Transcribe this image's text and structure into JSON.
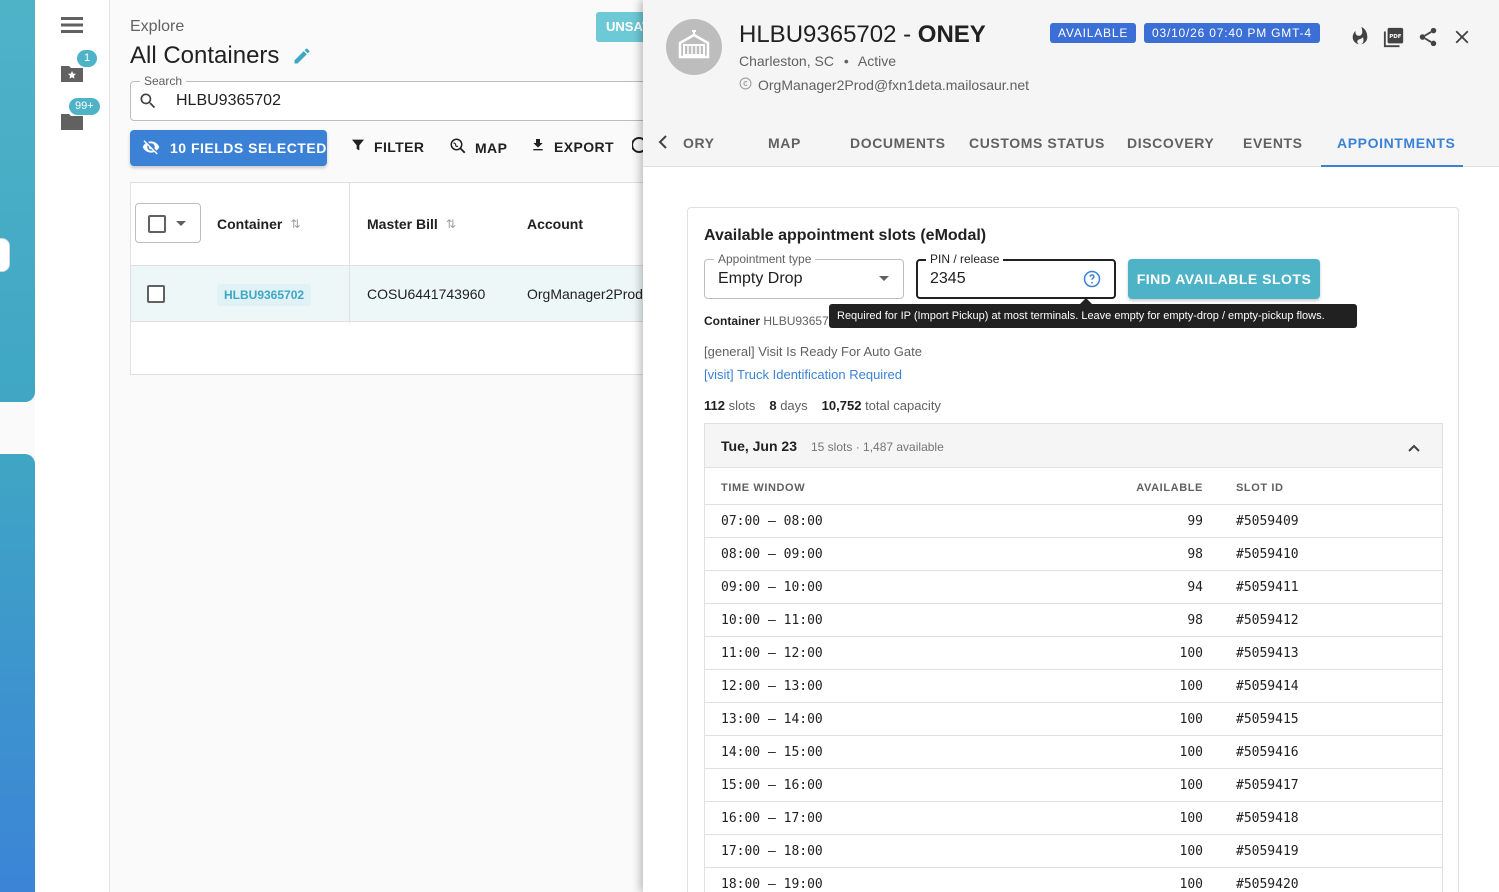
{
  "rail": {
    "favorites_badge": "1",
    "folders_badge": "99+"
  },
  "explore": {
    "section_label": "Explore",
    "page_title": "All Containers",
    "unsaved_label": "UNSAVED",
    "search_label": "Search",
    "search_value": "HLBU9365702",
    "fields_button": "10 FIELDS SELECTED",
    "filter_button": "FILTER",
    "map_button": "MAP",
    "export_button": "EXPORT",
    "columns": {
      "container": "Container",
      "master_bill": "Master Bill",
      "account": "Account"
    },
    "row": {
      "container": "HLBU9365702",
      "master_bill": "COSU6441743960",
      "account": "OrgManager2Prod"
    }
  },
  "detail": {
    "container_id": "HLBU9365702",
    "carrier": "ONEY",
    "location": "Charleston, SC",
    "status": "Active",
    "email": "OrgManager2Prod@fxn1deta.mailosaur.net",
    "availability_chip": "AVAILABLE",
    "timestamp_chip": "03/10/26 07:40 PM GMT-4",
    "pdf_icon_label": "PDF",
    "tabs": [
      "ORY",
      "MAP",
      "DOCUMENTS",
      "CUSTOMS STATUS",
      "DISCOVERY",
      "EVENTS",
      "APPOINTMENTS"
    ],
    "active_tab": "APPOINTMENTS"
  },
  "appointments": {
    "title": "Available appointment slots (eModal)",
    "type_label": "Appointment type",
    "type_value": "Empty Drop",
    "pin_label": "PIN / release",
    "pin_value": "2345",
    "find_button": "FIND AVAILABLE SLOTS",
    "tooltip": "Required for IP (Import Pickup) at most terminals. Leave empty for empty-drop / empty-pickup flows.",
    "container_label": "Container",
    "container_value": "HLBU93657",
    "message_general": "[general] Visit Is Ready For Auto Gate",
    "message_visit": "[visit] Truck Identification Required",
    "stats": {
      "slots": "112",
      "slots_label": "slots",
      "days": "8",
      "days_label": "days",
      "capacity": "10,752",
      "capacity_label": "total capacity"
    },
    "day": {
      "title": "Tue, Jun 23",
      "meta": "15 slots · 1,487 available",
      "col_time": "TIME WINDOW",
      "col_available": "AVAILABLE",
      "col_slot": "SLOT ID",
      "rows": [
        {
          "time": "07:00 – 08:00",
          "available": "99",
          "slot": "#5059409"
        },
        {
          "time": "08:00 – 09:00",
          "available": "98",
          "slot": "#5059410"
        },
        {
          "time": "09:00 – 10:00",
          "available": "94",
          "slot": "#5059411"
        },
        {
          "time": "10:00 – 11:00",
          "available": "98",
          "slot": "#5059412"
        },
        {
          "time": "11:00 – 12:00",
          "available": "100",
          "slot": "#5059413"
        },
        {
          "time": "12:00 – 13:00",
          "available": "100",
          "slot": "#5059414"
        },
        {
          "time": "13:00 – 14:00",
          "available": "100",
          "slot": "#5059415"
        },
        {
          "time": "14:00 – 15:00",
          "available": "100",
          "slot": "#5059416"
        },
        {
          "time": "15:00 – 16:00",
          "available": "100",
          "slot": "#5059417"
        },
        {
          "time": "16:00 – 17:00",
          "available": "100",
          "slot": "#5059418"
        },
        {
          "time": "17:00 – 18:00",
          "available": "100",
          "slot": "#5059419"
        },
        {
          "time": "18:00 – 19:00",
          "available": "100",
          "slot": "#5059420"
        }
      ]
    }
  }
}
